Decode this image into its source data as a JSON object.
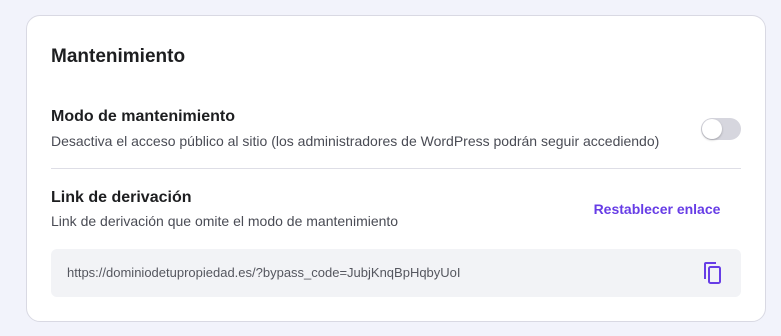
{
  "card": {
    "title": "Mantenimiento"
  },
  "maintenance_mode": {
    "title": "Modo de mantenimiento",
    "description": "Desactiva el acceso público al sitio (los administradores de WordPress podrán seguir accediendo)",
    "enabled": false
  },
  "bypass_link": {
    "title": "Link de derivación",
    "description": "Link de derivación que omite el modo de mantenimiento",
    "reset_label": "Restablecer enlace",
    "url": "https://dominiodetupropiedad.es/?bypass_code=JubjKnqBpHqbyUoI",
    "copy_icon": "copy-icon"
  },
  "colors": {
    "accent": "#673de6",
    "toggle_off": "#d6d6de",
    "card_bg": "#ffffff",
    "page_bg": "#f2f3fb"
  }
}
